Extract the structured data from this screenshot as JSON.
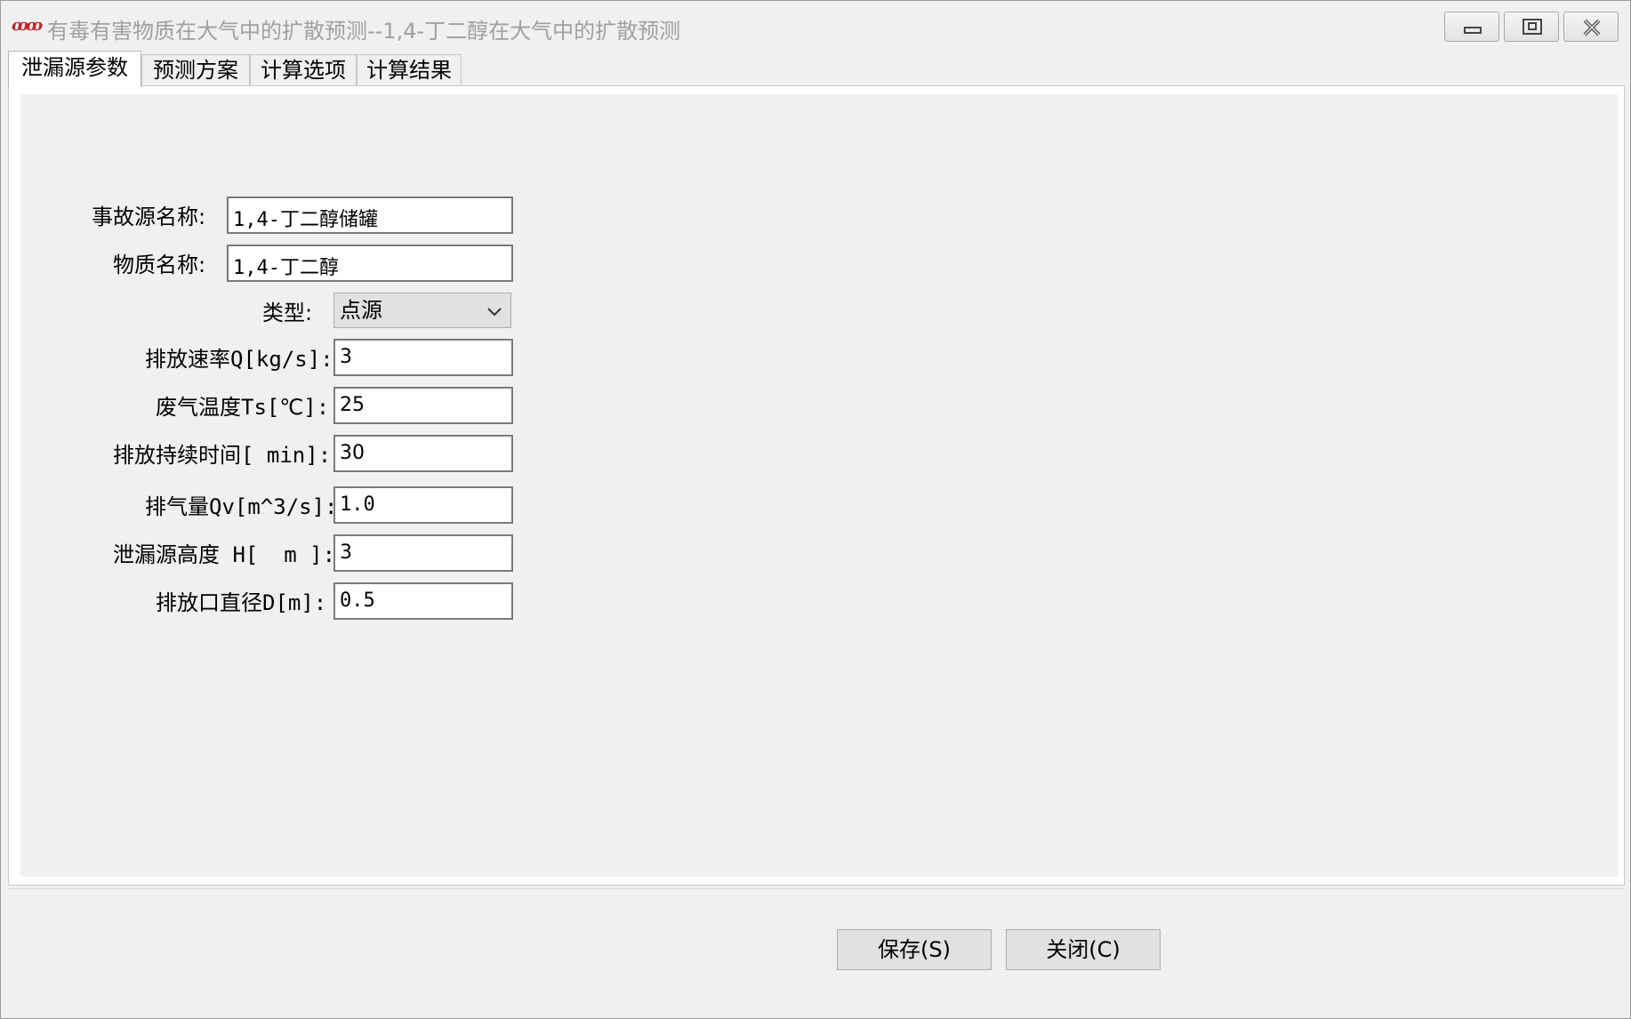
{
  "window": {
    "title": "有毒有害物质在大气中的扩散预测--1,4-丁二醇在大气中的扩散预测",
    "icon": "app-logo-icon",
    "controls": [
      "minimize-icon",
      "restore-icon",
      "close-icon"
    ]
  },
  "tabs": [
    {
      "label": "泄漏源参数",
      "active": true
    },
    {
      "label": "预测方案",
      "active": false
    },
    {
      "label": "计算选项",
      "active": false
    },
    {
      "label": "计算结果",
      "active": false
    }
  ],
  "form": {
    "source_name": {
      "label": "事故源名称:",
      "value": "1,4-丁二醇储罐"
    },
    "substance_name": {
      "label": "物质名称:",
      "value": "1,4-丁二醇"
    },
    "type": {
      "label": "类型:",
      "value": "点源"
    },
    "emission_rate": {
      "label": "排放速率Q[kg/s]:",
      "value": "3"
    },
    "gas_temp": {
      "label": "废气温度Ts[℃]:",
      "value": "25"
    },
    "duration": {
      "label": "排放持续时间[ min]:",
      "value": "30"
    },
    "gas_volume": {
      "label": "排气量Qv[m^3/s]:",
      "value": "1.0"
    },
    "source_height": {
      "label": "泄漏源高度 H[  m ]:",
      "value": "3"
    },
    "outlet_diameter": {
      "label": "排放口直径D[m]:",
      "value": "0.5"
    }
  },
  "buttons": {
    "save": "保存(S)",
    "close": "关闭(C)"
  }
}
